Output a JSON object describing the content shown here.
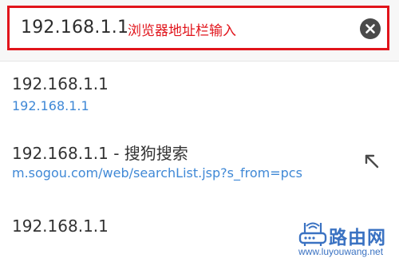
{
  "address_bar": {
    "value": "192.168.1.1",
    "annotation": "浏览器地址栏输入",
    "clear_icon": "close-circle-icon",
    "border_color": "#e1141b"
  },
  "suggestions": [
    {
      "title": "192.168.1.1",
      "url": "192.168.1.1"
    },
    {
      "title": "192.168.1.1 - 搜狗搜索",
      "url": "m.sogou.com/web/searchList.jsp?s_from=pcs",
      "action_icon": "arrow-up-left-icon"
    },
    {
      "title": "192.168.1.1"
    }
  ],
  "watermark": {
    "title": "路由网",
    "url": "www.luyouwang.net",
    "icon": "router-icon",
    "color": "#3a72c2"
  }
}
